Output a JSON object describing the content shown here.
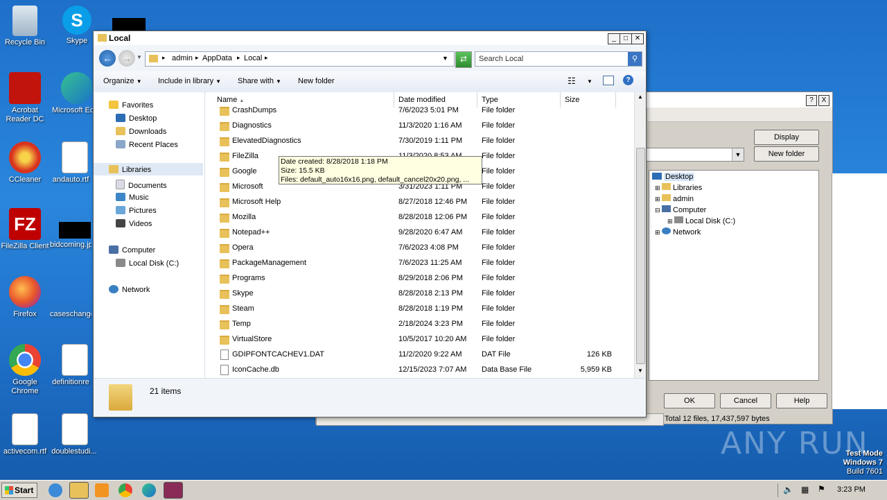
{
  "desktop": {
    "icons": [
      {
        "label": "Recycle Bin"
      },
      {
        "label": "Skype"
      },
      {
        "label": "Acrobat Reader DC"
      },
      {
        "label": "Microsoft Edge"
      },
      {
        "label": "CCleaner"
      },
      {
        "label": "andauto.rtf"
      },
      {
        "label": "FileZilla Client"
      },
      {
        "label": "bidcoming.jpg"
      },
      {
        "label": "Firefox"
      },
      {
        "label": "caseschange"
      },
      {
        "label": "Google Chrome"
      },
      {
        "label": "definitionre"
      },
      {
        "label": "activecom.rtf"
      },
      {
        "label": "doublestudi..."
      }
    ],
    "watermark": "ANY RUN",
    "test_mode": {
      "line1": "Test Mode",
      "line2": "Windows 7",
      "line3": "Build 7601"
    }
  },
  "background_dialog": {
    "help_btn": "?",
    "close_btn": "X",
    "display_btn": "Display",
    "new_folder_btn": "New folder",
    "tree": [
      "Desktop",
      "Libraries",
      "admin",
      "Computer",
      "Local Disk (C:)",
      "Network"
    ],
    "ok_btn": "OK",
    "cancel_btn": "Cancel",
    "help_btn2": "Help",
    "total": "Total 12 files, 17,437,597 bytes"
  },
  "explorer": {
    "title": "Local",
    "breadcrumb": [
      "admin",
      "AppData",
      "Local"
    ],
    "search_placeholder": "Search Local",
    "toolbar": {
      "organize": "Organize",
      "include": "Include in library",
      "share": "Share with",
      "new_folder": "New folder"
    },
    "nav": {
      "favorites": "Favorites",
      "desktop": "Desktop",
      "downloads": "Downloads",
      "recent": "Recent Places",
      "libraries": "Libraries",
      "documents": "Documents",
      "music": "Music",
      "pictures": "Pictures",
      "videos": "Videos",
      "computer": "Computer",
      "localdisk": "Local Disk (C:)",
      "network": "Network"
    },
    "columns": {
      "name": "Name",
      "date": "Date modified",
      "type": "Type",
      "size": "Size"
    },
    "rows": [
      {
        "name": "CrashDumps",
        "date": "7/6/2023 5:01 PM",
        "type": "File folder",
        "size": "",
        "kind": "folder"
      },
      {
        "name": "Diagnostics",
        "date": "11/3/2020 1:16 AM",
        "type": "File folder",
        "size": "",
        "kind": "folder"
      },
      {
        "name": "ElevatedDiagnostics",
        "date": "7/30/2019 1:11 PM",
        "type": "File folder",
        "size": "",
        "kind": "folder"
      },
      {
        "name": "FileZilla",
        "date": "11/3/2020 8:53 AM",
        "type": "File folder",
        "size": "",
        "kind": "folder"
      },
      {
        "name": "Google",
        "date": "8/28/2018 1:18 PM",
        "type": "File folder",
        "size": "",
        "kind": "folder"
      },
      {
        "name": "Microsoft",
        "date": "3/31/2023 1:11 PM",
        "type": "File folder",
        "size": "",
        "kind": "folder"
      },
      {
        "name": "Microsoft Help",
        "date": "8/27/2018 12:46 PM",
        "type": "File folder",
        "size": "",
        "kind": "folder"
      },
      {
        "name": "Mozilla",
        "date": "8/28/2018 12:06 PM",
        "type": "File folder",
        "size": "",
        "kind": "folder"
      },
      {
        "name": "Notepad++",
        "date": "9/28/2020 6:47 AM",
        "type": "File folder",
        "size": "",
        "kind": "folder"
      },
      {
        "name": "Opera",
        "date": "7/6/2023 4:08 PM",
        "type": "File folder",
        "size": "",
        "kind": "folder"
      },
      {
        "name": "PackageManagement",
        "date": "7/6/2023 11:25 AM",
        "type": "File folder",
        "size": "",
        "kind": "folder"
      },
      {
        "name": "Programs",
        "date": "8/29/2018 2:06 PM",
        "type": "File folder",
        "size": "",
        "kind": "folder"
      },
      {
        "name": "Skype",
        "date": "8/28/2018 2:13 PM",
        "type": "File folder",
        "size": "",
        "kind": "folder"
      },
      {
        "name": "Steam",
        "date": "8/28/2018 1:19 PM",
        "type": "File folder",
        "size": "",
        "kind": "folder"
      },
      {
        "name": "Temp",
        "date": "2/18/2024 3:23 PM",
        "type": "File folder",
        "size": "",
        "kind": "folder"
      },
      {
        "name": "VirtualStore",
        "date": "10/5/2017 10:20 AM",
        "type": "File folder",
        "size": "",
        "kind": "folder"
      },
      {
        "name": "GDIPFONTCACHEV1.DAT",
        "date": "11/2/2020 9:22 AM",
        "type": "DAT File",
        "size": "126 KB",
        "kind": "file"
      },
      {
        "name": "IconCache.db",
        "date": "12/15/2023 7:07 AM",
        "type": "Data Base File",
        "size": "5,959 KB",
        "kind": "file"
      }
    ],
    "tooltip": {
      "line1": "Date created: 8/28/2018 1:18 PM",
      "line2": "Size: 15.5 KB",
      "line3": "Files: default_auto16x16.png, default_cancel20x20.png, ..."
    },
    "status": "21 items"
  },
  "taskbar": {
    "start": "Start",
    "clock": "3:23 PM"
  }
}
